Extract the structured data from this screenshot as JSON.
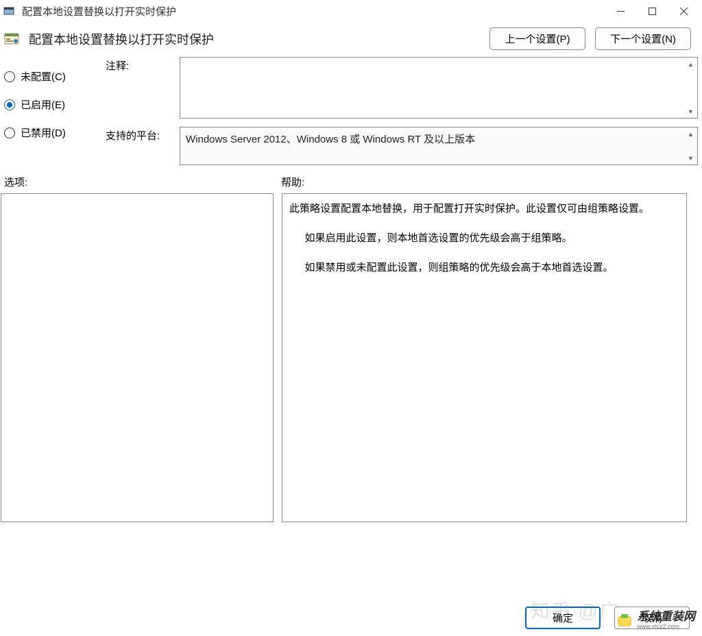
{
  "window": {
    "title": "配置本地设置替换以打开实时保护"
  },
  "header": {
    "title": "配置本地设置替换以打开实时保护",
    "prev_button": "上一个设置(P)",
    "next_button": "下一个设置(N)"
  },
  "radios": {
    "not_configured": "未配置(C)",
    "enabled": "已启用(E)",
    "disabled": "已禁用(D)",
    "selected": "enabled"
  },
  "fields": {
    "comment_label": "注释:",
    "comment_value": "",
    "platform_label": "支持的平台:",
    "platform_value": "Windows Server 2012、Windows 8 或 Windows RT 及以上版本"
  },
  "sections": {
    "options_label": "选项:",
    "help_label": "帮助:"
  },
  "help": {
    "p1": "此策略设置配置本地替换，用于配置打开实时保护。此设置仅可由组策略设置。",
    "p2": "如果启用此设置，则本地首选设置的优先级会高于组策略。",
    "p3": "如果禁用或未配置此设置，则组策略的优先级会高于本地首选设置。"
  },
  "buttons": {
    "ok": "确定",
    "cancel": "取消"
  },
  "watermark": {
    "main": "系统重装网",
    "sub": "www.xtcz2.com",
    "bg": "知乎 @广"
  }
}
